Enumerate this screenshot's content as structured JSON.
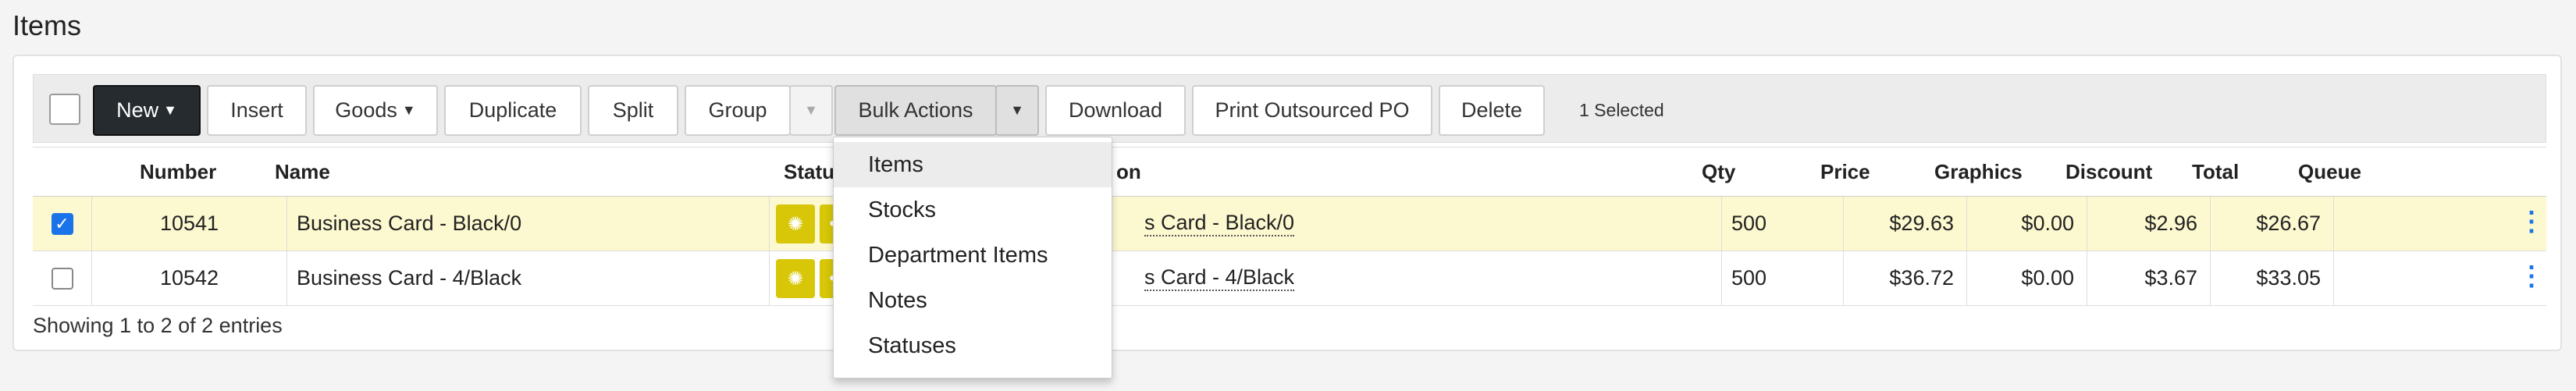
{
  "page": {
    "title": "Items"
  },
  "toolbar": {
    "new_label": "New",
    "insert_label": "Insert",
    "goods_label": "Goods",
    "duplicate_label": "Duplicate",
    "split_label": "Split",
    "group_label": "Group",
    "bulk_actions_label": "Bulk Actions",
    "download_label": "Download",
    "print_po_label": "Print Outsourced PO",
    "delete_label": "Delete",
    "selected_text": "1 Selected"
  },
  "table": {
    "headers": {
      "number": "Number",
      "name": "Name",
      "status": "Status",
      "description": "on",
      "qty": "Qty",
      "price": "Price",
      "graphics": "Graphics",
      "discount": "Discount",
      "total": "Total",
      "queue": "Queue"
    },
    "rows": [
      {
        "checked": true,
        "number": "10541",
        "name": "Business Card - Black/0",
        "description": "s Card - Black/0",
        "qty": "500",
        "price": "$29.63",
        "graphics": "$0.00",
        "discount": "$2.96",
        "total": "$26.67",
        "queue": ""
      },
      {
        "checked": false,
        "number": "10542",
        "name": "Business Card - 4/Black",
        "description": "s Card - 4/Black",
        "qty": "500",
        "price": "$36.72",
        "graphics": "$0.00",
        "discount": "$3.67",
        "total": "$33.05",
        "queue": ""
      }
    ],
    "footer": "Showing 1 to 2 of 2 entries"
  },
  "bulk_dropdown": {
    "items": [
      "Items",
      "Stocks",
      "Department Items",
      "Notes",
      "Statuses"
    ],
    "hovered": "Items"
  },
  "icons": {
    "spinner": "loading-spinner-icon",
    "more": "ellipsis-icon",
    "kebab": "vertical-ellipsis-icon",
    "caret": "caret-down-icon"
  },
  "colors": {
    "selected_row": "#fcf8cf",
    "status_button": "#d7c708",
    "primary_button": "#262b30",
    "kebab": "#1a73e8"
  }
}
